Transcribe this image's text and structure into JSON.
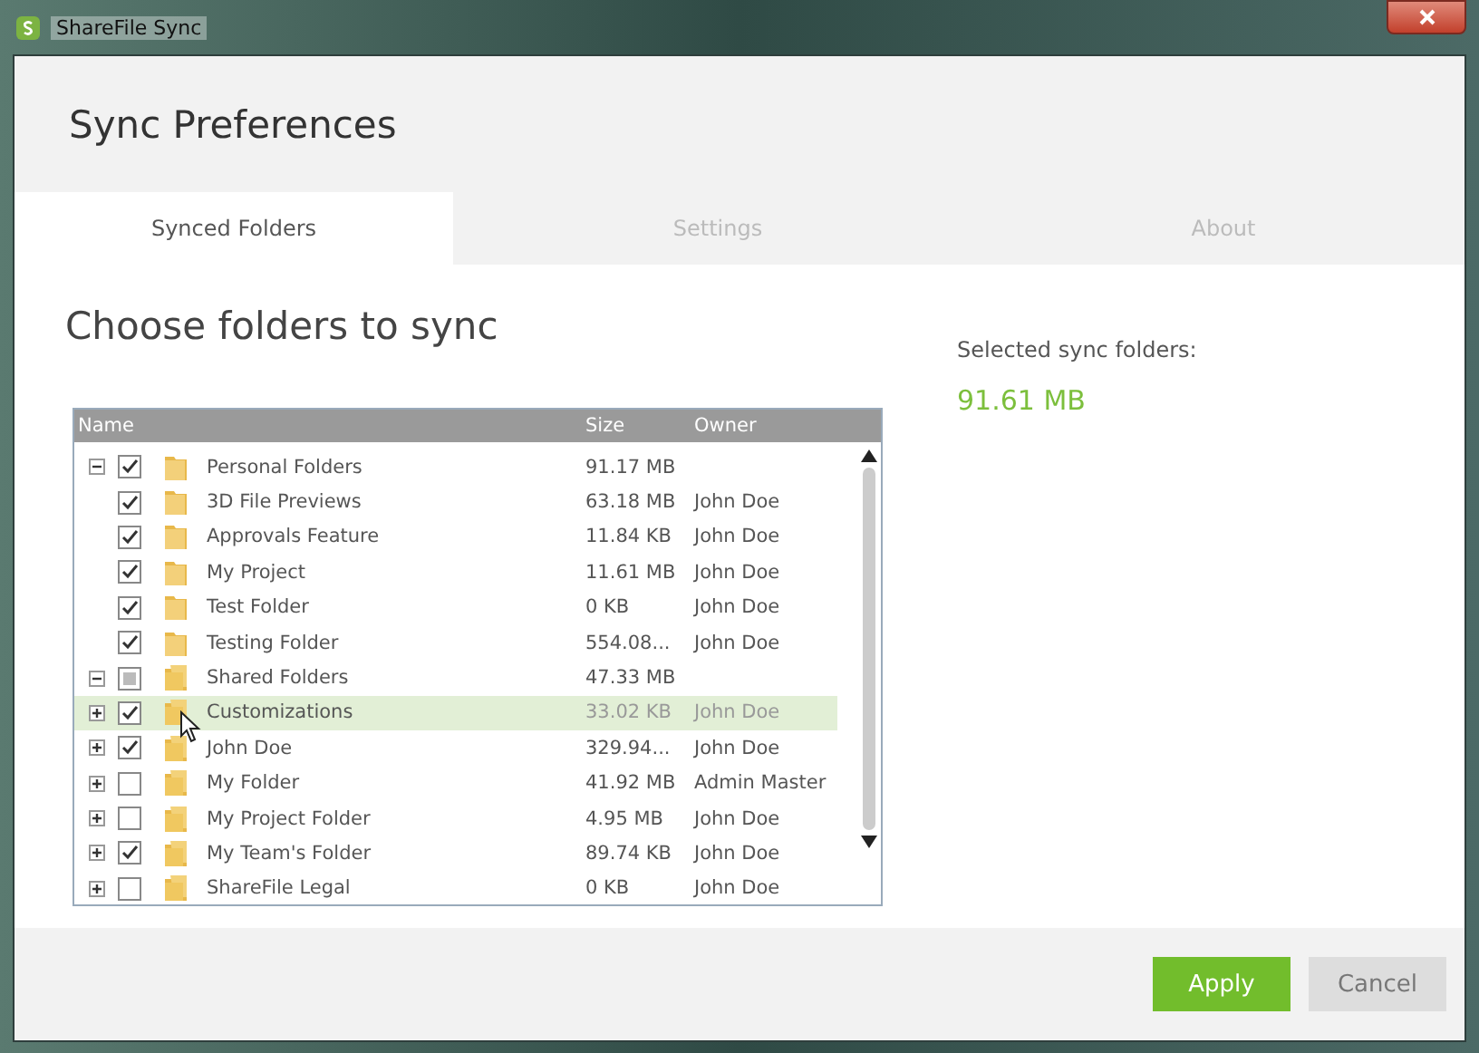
{
  "window": {
    "title": "ShareFile Sync"
  },
  "header": {
    "title": "Sync Preferences"
  },
  "tabs": [
    {
      "label": "Synced Folders",
      "selected": true
    },
    {
      "label": "Settings",
      "selected": false
    },
    {
      "label": "About",
      "selected": false
    }
  ],
  "section_title": "Choose folders to sync",
  "table": {
    "columns": [
      "Name",
      "Size",
      "Owner"
    ],
    "rows": [
      {
        "name": "Personal Folders",
        "size": "91.17 MB",
        "kind": "folder",
        "checked": true,
        "expanded": true,
        "selected": false,
        "children": [
          {
            "name": "3D File Previews",
            "size": "63.18 MB",
            "owner": "John Doe",
            "kind": "folder",
            "checked": true,
            "selected": false
          },
          {
            "name": "Approvals Feature",
            "size": "11.84 KB",
            "owner": "John Doe",
            "kind": "folder",
            "checked": true,
            "selected": false
          },
          {
            "name": "My Project",
            "size": "11.61 MB",
            "owner": "John Doe",
            "kind": "folder",
            "checked": true,
            "selected": false
          },
          {
            "name": "Test Folder",
            "size": "0 KB",
            "owner": "John Doe",
            "kind": "folder",
            "checked": true,
            "selected": false
          },
          {
            "name": "Testing Folder",
            "size": "554.08...",
            "owner": "John Doe",
            "kind": "folder",
            "checked": true,
            "selected": false
          }
        ]
      },
      {
        "name": "Shared Folders",
        "size": "47.33 MB",
        "kind": "shared_folder",
        "partial": true,
        "expanded": true,
        "selected": false,
        "children": [
          {
            "name": "Customizations",
            "size": "33.02 KB",
            "owner": "John Doe",
            "kind": "shared_folder",
            "checked": true,
            "expanded": false,
            "selected": true
          },
          {
            "name": "John Doe",
            "size": "329.94...",
            "owner": "John Doe",
            "kind": "shared_folder",
            "checked": true,
            "expanded": false,
            "selected": false
          },
          {
            "name": "My Folder",
            "size": "41.92 MB",
            "owner": "Admin Master",
            "kind": "shared_folder",
            "checked": false,
            "expanded": false,
            "selected": false
          },
          {
            "name": "My Project Folder",
            "size": "4.95 MB",
            "owner": "John Doe",
            "kind": "shared_folder",
            "checked": false,
            "expanded": false,
            "selected": false
          },
          {
            "name": "My Team's Folder",
            "size": "89.74 KB",
            "owner": "John Doe",
            "kind": "shared_folder",
            "checked": true,
            "expanded": false,
            "selected": false
          },
          {
            "name": "ShareFile Legal",
            "size": "0 KB",
            "owner": "John Doe",
            "kind": "shared_folder",
            "checked": false,
            "expanded": false,
            "selected": false
          }
        ]
      }
    ]
  },
  "summary": {
    "label": "Selected sync folders:",
    "value": "91.61 MB"
  },
  "buttons": [
    {
      "label": "Apply",
      "kind": "primary"
    },
    {
      "label": "Cancel",
      "kind": "secondary"
    }
  ]
}
